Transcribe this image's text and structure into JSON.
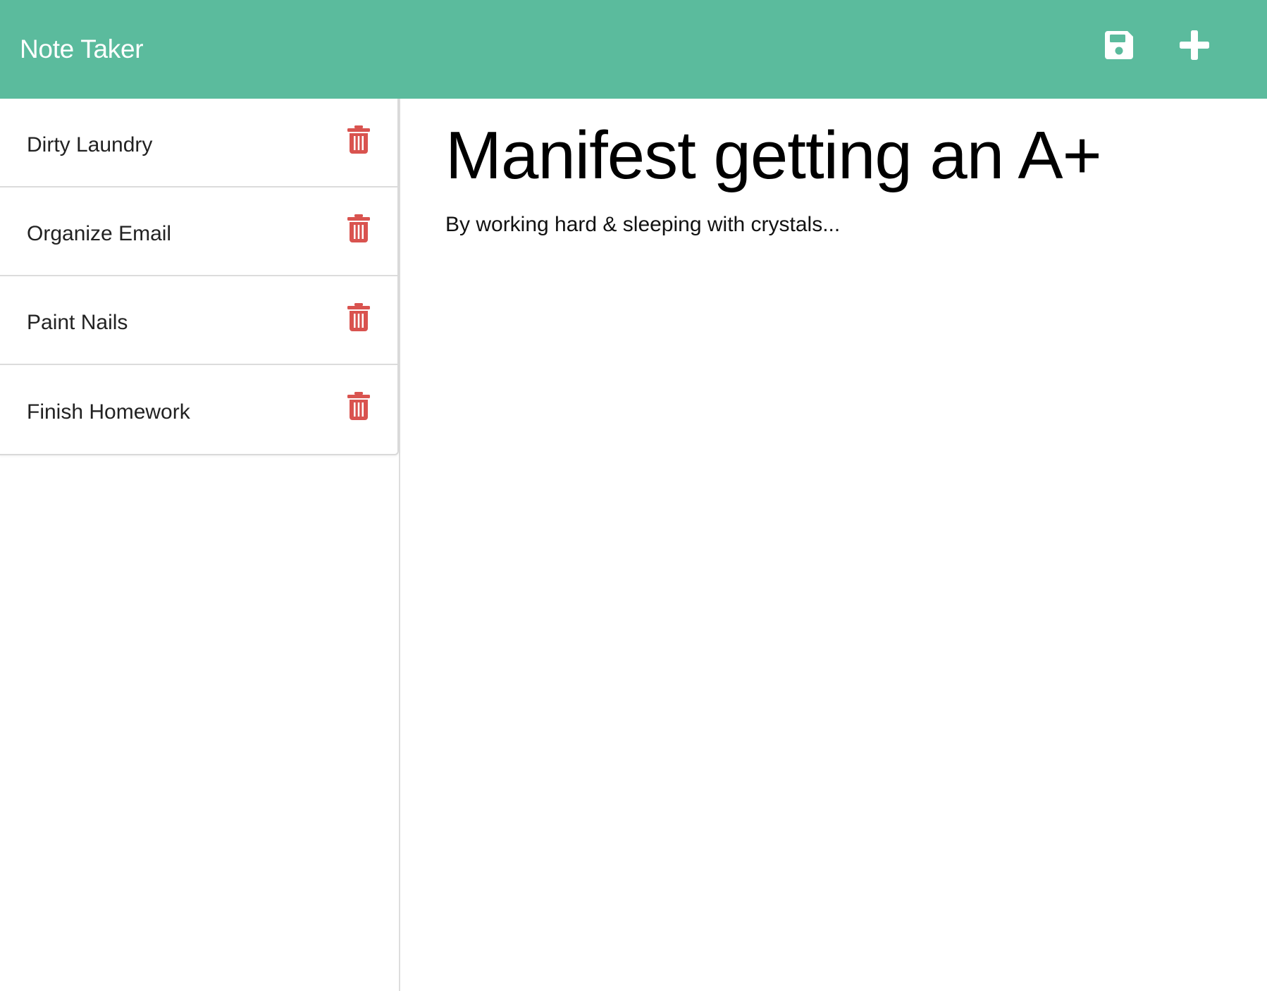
{
  "app": {
    "title": "Note Taker"
  },
  "colors": {
    "navbar": "#5bbb9d",
    "delete_icon": "#d9534f",
    "nav_icon": "#ffffff"
  },
  "header": {
    "save_icon": "floppy-disk",
    "new_icon": "plus"
  },
  "notes": [
    {
      "title": "Dirty Laundry",
      "delete_icon": "trash"
    },
    {
      "title": "Organize Email",
      "delete_icon": "trash"
    },
    {
      "title": "Paint Nails",
      "delete_icon": "trash"
    },
    {
      "title": "Finish Homework",
      "delete_icon": "trash"
    }
  ],
  "active_note": {
    "title": "Manifest getting an A+",
    "text": "By working hard & sleeping with crystals..."
  }
}
